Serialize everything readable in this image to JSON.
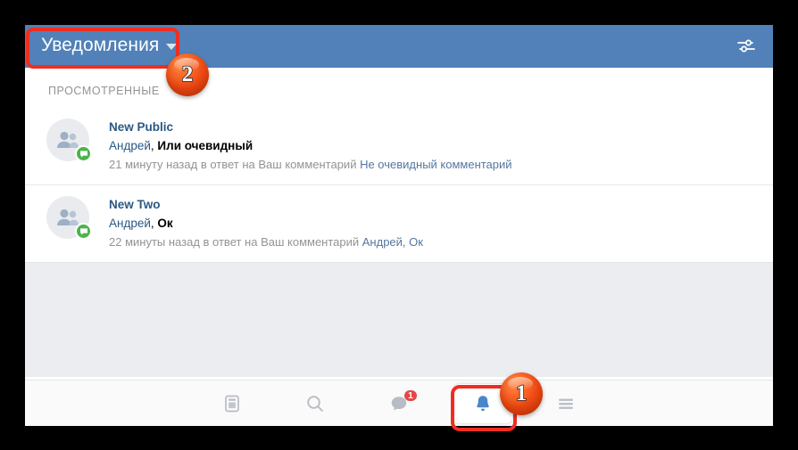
{
  "header": {
    "title": "Уведомления",
    "caret_icon": "chevron-down-icon",
    "settings_icon": "sliders-icon"
  },
  "content": {
    "section_label": "ПРОСМОТРЕННЫЕ",
    "notifications": [
      {
        "avatar_icon": "group-avatar-icon",
        "badge_icon": "comment-bubble-icon",
        "title": "New Public",
        "author": "Андрей",
        "separator": ", ",
        "comment": "Или очевидный",
        "meta_prefix": "21 минуту назад в ответ на Ваш комментарий ",
        "meta_link": "Не очевидный комментарий"
      },
      {
        "avatar_icon": "group-avatar-icon",
        "badge_icon": "comment-bubble-icon",
        "title": "New Two",
        "author": "Андрей",
        "separator": ", ",
        "comment": "Ок",
        "meta_prefix": "22 минуты назад в ответ на Ваш комментарий ",
        "meta_link": "Андрей, Ок"
      }
    ]
  },
  "bottom_nav": {
    "items": [
      {
        "name": "newsfeed",
        "icon": "newsfeed-icon",
        "badge": "",
        "active": false
      },
      {
        "name": "search",
        "icon": "search-icon",
        "badge": "",
        "active": false
      },
      {
        "name": "messages",
        "icon": "messages-icon",
        "badge": "1",
        "active": false
      },
      {
        "name": "notifications",
        "icon": "bell-icon",
        "badge": "",
        "active": true
      },
      {
        "name": "menu",
        "icon": "hamburger-menu-icon",
        "badge": "",
        "active": false
      }
    ]
  },
  "callouts": [
    {
      "label": "1",
      "target": "notifications-tab"
    },
    {
      "label": "2",
      "target": "header-title-dropdown"
    }
  ],
  "colors": {
    "header_blue": "#5181b8",
    "link_blue": "#2a5885",
    "active_blue": "#4986cc",
    "badge_red": "#e64646",
    "badge_green": "#4bb34b",
    "callout_orange": "#ef4a14",
    "highlight_red": "#ef2e21",
    "empty_grey": "#ebedf0"
  }
}
